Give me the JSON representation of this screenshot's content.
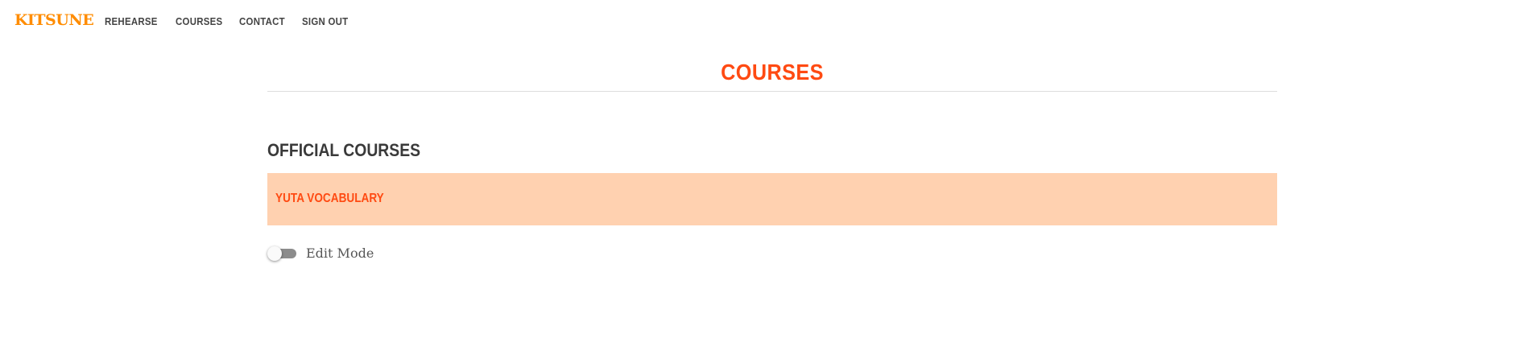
{
  "navbar": {
    "brand": "KITSUNE",
    "links": [
      {
        "label": "REHEARSE"
      },
      {
        "label": "COURSES"
      },
      {
        "label": "CONTACT"
      },
      {
        "label": "SIGN OUT"
      }
    ]
  },
  "main": {
    "title": "COURSES",
    "sections": [
      {
        "heading": "OFFICIAL COURSES",
        "courses": [
          {
            "name": "YUTA VOCABULARY"
          }
        ]
      }
    ],
    "edit_mode": {
      "label": "Edit Mode",
      "enabled": false
    }
  },
  "colors": {
    "brand": "#ff8c00",
    "accent": "#ff4a12",
    "course_card_bg": "#ffd1b0",
    "toggle_track": "#8c8c8c"
  }
}
